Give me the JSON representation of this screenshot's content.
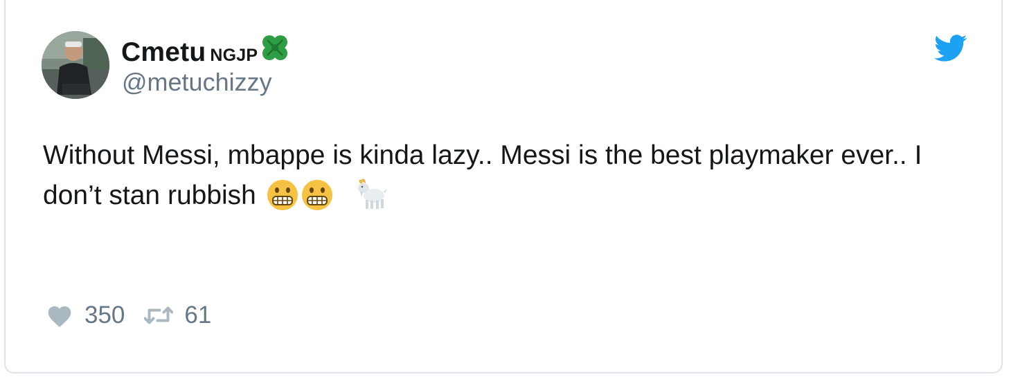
{
  "user": {
    "display_name": "Cmetu",
    "name_suffix": "NGJP",
    "handle": "@metuchizzy"
  },
  "tweet": {
    "text": "Without Messi, mbappe is kinda lazy.. Messi is the best playmaker ever.. I don’t stan rubbish"
  },
  "stats": {
    "likes": "350",
    "retweets": "61"
  },
  "icons": {
    "name_badge": "four-leaf-clover-icon",
    "brand": "twitter-bird-icon",
    "emojis": [
      "grimacing-face-icon",
      "grimacing-face-icon",
      "goat-icon"
    ],
    "like": "heart-icon",
    "retweet": "retweet-icon"
  },
  "colors": {
    "text": "#14171a",
    "secondary": "#657786",
    "brand": "#1da1f2",
    "clover": "#2e9e44",
    "emoji": "#f6c244",
    "card_border": "#dde3e8"
  }
}
